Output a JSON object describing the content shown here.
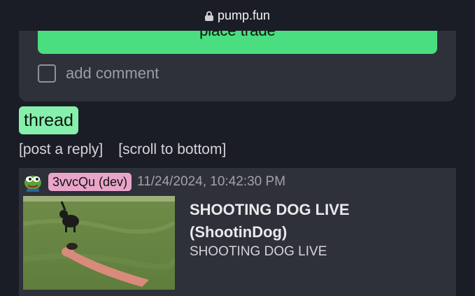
{
  "browser": {
    "url": "pump.fun",
    "lock_icon": "lock-icon"
  },
  "trade_panel": {
    "place_trade_label": "place trade",
    "add_comment_label": "add comment",
    "add_comment_checked": false,
    "button_color": "#4ade80"
  },
  "thread": {
    "label": "thread",
    "post_reply_link": "[post a reply]",
    "scroll_bottom_link": "[scroll to bottom]"
  },
  "post": {
    "avatar_icon": "pepe-frog-avatar",
    "user": "3vvcQu (dev)",
    "timestamp": "11/24/2024, 10:42:30 PM",
    "title_line1": "SHOOTING DOG LIVE",
    "title_line2": "(ShootinDog)",
    "description": "SHOOTING DOG LIVE",
    "image_icon": "dog-on-grass-photo"
  }
}
